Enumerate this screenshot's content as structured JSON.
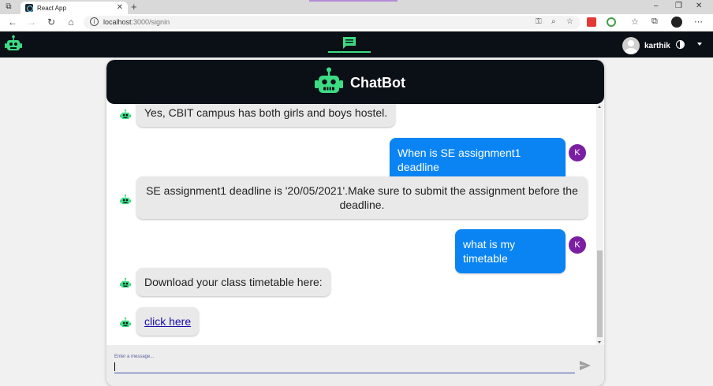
{
  "browser": {
    "tab_title": "React App",
    "tab_close": "✕",
    "new_tab": "+",
    "url_host": "localhost",
    "url_rest": ":3000/signin",
    "win_min": "–",
    "win_max": "❐",
    "win_close": "✕"
  },
  "appnav": {
    "username": "karthik"
  },
  "chat": {
    "title": "ChatBot",
    "input_placeholder": "Enter a message...",
    "messages": [
      {
        "sender": "bot",
        "text": "Yes, CBIT campus has both girls and boys hostel."
      },
      {
        "sender": "user",
        "text": "When is SE assignment1 deadline",
        "avatar": "K"
      },
      {
        "sender": "bot",
        "line1": "SE assignment1 deadline is '20/05/2021'.Make sure to submit the assignment before the",
        "line2": "deadline."
      },
      {
        "sender": "user",
        "text": "what is my timetable",
        "avatar": "K"
      },
      {
        "sender": "bot",
        "text": "Download your class timetable here:"
      },
      {
        "sender": "bot",
        "link": "click here"
      }
    ]
  },
  "colors": {
    "nav_bg": "#0a1016",
    "accent_green": "#3ddc84",
    "user_bubble": "#0b84f3",
    "user_avatar": "#7b1fa2",
    "bot_bubble": "#e9e9e9"
  }
}
